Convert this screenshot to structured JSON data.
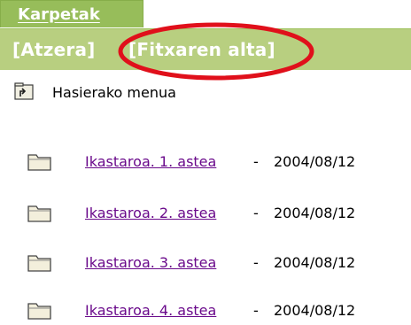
{
  "tab": {
    "label": "Karpetak"
  },
  "toolbar": {
    "back_label": "[Atzera]",
    "new_file_label": "[Fitxaren alta]",
    "highlight_color": "#e0101b"
  },
  "home": {
    "label": "Hasierako menua",
    "icon": "folder-up-icon"
  },
  "folders": [
    {
      "name": "Ikastaroa. 1. astea",
      "separator": " - ",
      "date": "2004/08/12",
      "icon": "folder-icon"
    },
    {
      "name": "Ikastaroa. 2. astea",
      "separator": " - ",
      "date": "2004/08/12",
      "icon": "folder-icon"
    },
    {
      "name": "Ikastaroa. 3. astea",
      "separator": " - ",
      "date": "2004/08/12",
      "icon": "folder-icon"
    },
    {
      "name": "Ikastaroa. 4. astea",
      "separator": " - ",
      "date": "2004/08/12",
      "icon": "folder-icon"
    }
  ],
  "colors": {
    "tab_green": "#97bd5a",
    "toolbar_green": "#b8cf80",
    "link_visited": "#6a0a8b"
  }
}
